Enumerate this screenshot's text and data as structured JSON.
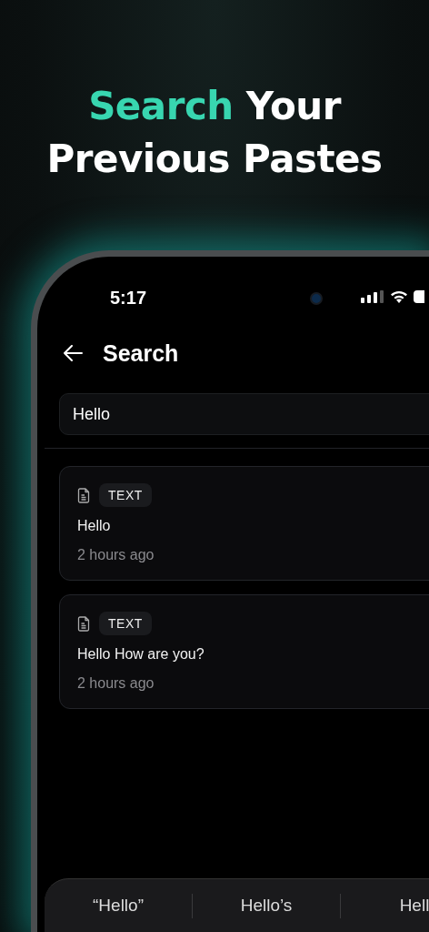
{
  "headline": [
    {
      "text": "Search",
      "accent": true
    },
    {
      "text": " Your",
      "accent": false
    },
    {
      "text": "Previous Pastes",
      "accent": false,
      "new_line": true
    }
  ],
  "status_bar": {
    "time": "5:17"
  },
  "header": {
    "title": "Search"
  },
  "search": {
    "value": "Hello"
  },
  "results": [
    {
      "type": "TEXT",
      "content": "Hello",
      "time": "2 hours ago"
    },
    {
      "type": "TEXT",
      "content": "Hello How are you?",
      "time": "2 hours ago"
    }
  ],
  "suggestions": [
    "“Hello”",
    "Hello’s",
    "Hell"
  ]
}
